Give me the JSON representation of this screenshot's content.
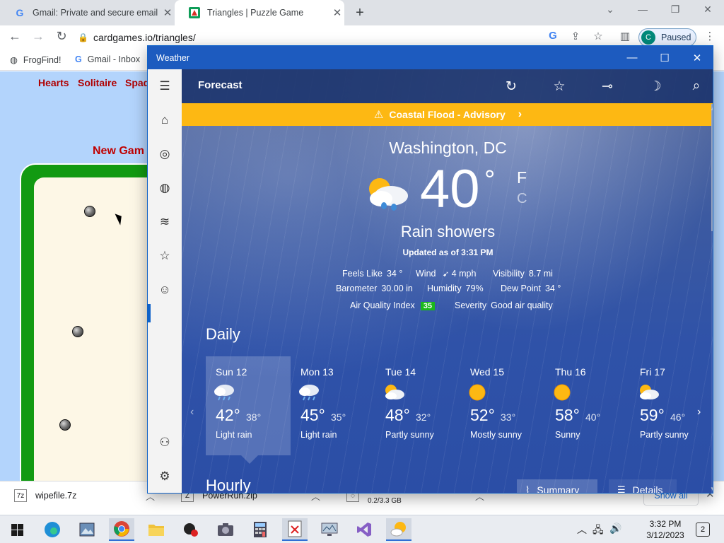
{
  "browser": {
    "tabs": [
      {
        "title": "Gmail: Private and secure email a",
        "favicon": "google-g-icon"
      },
      {
        "title": "Triangles | Puzzle Game",
        "favicon": "puzzle-icon"
      }
    ],
    "url": "cardgames.io/triangles/",
    "profile_status": "Paused",
    "profile_initial": "C",
    "bookmarks": [
      {
        "label": "FrogFind!"
      },
      {
        "label": "Gmail - Inbox"
      }
    ]
  },
  "page": {
    "nav": [
      "Hearts",
      "Solitaire",
      "Spad"
    ],
    "new_game": "New Gam"
  },
  "downloads": {
    "items": [
      {
        "name": "wipefile.7z",
        "sub": ""
      },
      {
        "name": "PowerRun.zip",
        "sub": ""
      },
      {
        "name": "",
        "sub": "0.2/3.3 GB"
      }
    ],
    "show_all": "Show all"
  },
  "taskbar": {
    "time": "3:32 PM",
    "date": "3/12/2023",
    "notifications": "2"
  },
  "weather": {
    "window_title": "Weather",
    "heading": "Forecast",
    "alert": "Coastal Flood - Advisory",
    "location": "Washington, DC",
    "temperature": "40",
    "degree": "°",
    "unit_f": "F",
    "unit_c": "C",
    "condition": "Rain showers",
    "updated": "Updated as of 3:31 PM",
    "details": {
      "feels_like_label": "Feels Like",
      "feels_like": "34 °",
      "wind_label": "Wind",
      "wind": "4 mph",
      "visibility_label": "Visibility",
      "visibility": "8.7 mi",
      "barometer_label": "Barometer",
      "barometer": "30.00 in",
      "humidity_label": "Humidity",
      "humidity": "79%",
      "dew_point_label": "Dew Point",
      "dew_point": "34 °",
      "aqi_label": "Air Quality Index",
      "aqi": "35",
      "severity_label": "Severity",
      "severity": "Good air quality"
    },
    "daily_heading": "Daily",
    "days": [
      {
        "name": "Sun 12",
        "hi": "42°",
        "lo": "38°",
        "summary": "Light rain",
        "icon": "rain-icon"
      },
      {
        "name": "Mon 13",
        "hi": "45°",
        "lo": "35°",
        "summary": "Light rain",
        "icon": "rain-icon"
      },
      {
        "name": "Tue 14",
        "hi": "48°",
        "lo": "32°",
        "summary": "Partly sunny",
        "icon": "partly-sunny-icon"
      },
      {
        "name": "Wed 15",
        "hi": "52°",
        "lo": "33°",
        "summary": "Mostly sunny",
        "icon": "sun-icon"
      },
      {
        "name": "Thu 16",
        "hi": "58°",
        "lo": "40°",
        "summary": "Sunny",
        "icon": "sun-icon"
      },
      {
        "name": "Fri 17",
        "hi": "59°",
        "lo": "46°",
        "summary": "Partly sunny",
        "icon": "partly-sunny-icon"
      }
    ],
    "hourly_heading": "Hourly",
    "summary_label": "Summary",
    "details_label": "Details"
  },
  "colors": {
    "alert": "#fdb813",
    "titlebar": "#1d5bbf",
    "aqi_good": "#1bb81b"
  }
}
